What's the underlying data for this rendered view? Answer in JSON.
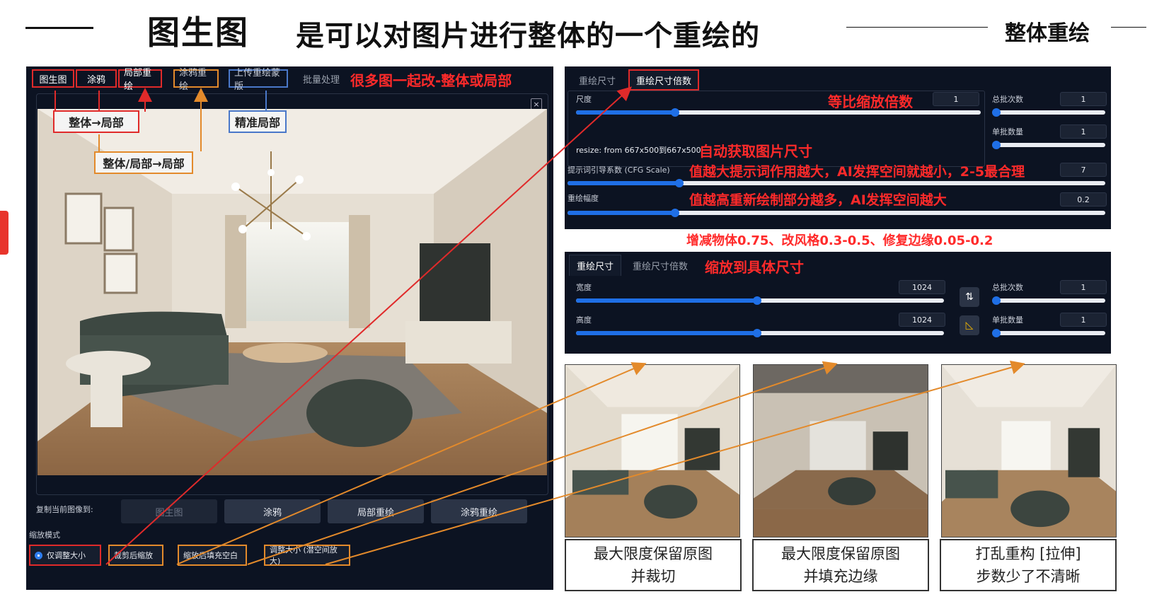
{
  "header": {
    "title": "图生图",
    "subtitle": "是可以对图片进行整体的一个重绘的",
    "right_label": "整体重绘"
  },
  "left_panel": {
    "tabs": [
      {
        "label": "图生图"
      },
      {
        "label": "涂鸦"
      },
      {
        "label": "局部重绘"
      },
      {
        "label": "涂鸦重绘"
      },
      {
        "label": "上传重绘蒙版"
      },
      {
        "label": "批量处理"
      }
    ],
    "tab_note": "很多图一起改-整体或局部",
    "callouts": {
      "whole_to_part": "整体→局部",
      "whole_part_to_part": "整体/局部→局部",
      "precise_part": "精准局部"
    },
    "close_label": "×",
    "copy_label": "复制当前图像到:",
    "copy_buttons": [
      {
        "label": "图生图"
      },
      {
        "label": "涂鸦"
      },
      {
        "label": "局部重绘"
      },
      {
        "label": "涂鸦重绘"
      }
    ],
    "scale_mode_label": "缩放模式",
    "scale_modes": [
      {
        "label": "仅调整大小",
        "selected": true
      },
      {
        "label": "裁剪后缩放",
        "selected": false
      },
      {
        "label": "缩放后填充空白",
        "selected": false
      },
      {
        "label": "调整大小 (潜空间放大)",
        "selected": false
      }
    ]
  },
  "panel_scale_by": {
    "tabs": [
      {
        "label": "重绘尺寸"
      },
      {
        "label": "重绘尺寸倍数"
      }
    ],
    "scale_label": "尺度",
    "scale_value": "1",
    "scale_note": "等比缩放倍数",
    "scale_fraction": 0.22,
    "resize_text": "resize: from 667x500到667x500",
    "resize_note": "自动获取图片尺寸",
    "batch_count_label": "总批次数",
    "batch_count_value": "1",
    "batch_size_label": "单批数量",
    "batch_size_value": "1",
    "cfg_label": "提示词引导系数 (CFG Scale)",
    "cfg_value": "7",
    "cfg_note": "值越大提示词作用越大，AI发挥空间就越小，2-5最合理",
    "denoise_label": "重绘幅度",
    "denoise_value": "0.2",
    "denoise_note": "值越高重新绘制部分越多，AI发挥空间越大"
  },
  "denoise_tip": "增减物体0.75、改风格0.3-0.5、修复边缘0.05-0.2",
  "panel_size": {
    "tabs": [
      {
        "label": "重绘尺寸"
      },
      {
        "label": "重绘尺寸倍数"
      }
    ],
    "tab_note": "缩放到具体尺寸",
    "width_label": "宽度",
    "width_value": "1024",
    "height_label": "高度",
    "height_value": "1024",
    "swap_icon": "swap-icon",
    "ratio_icon": "ruler-icon",
    "batch_count_label": "总批次数",
    "batch_count_value": "1",
    "batch_size_label": "单批数量",
    "batch_size_value": "1"
  },
  "thumbnails": [
    {
      "line1": "最大限度保留原图",
      "line2": "并裁切"
    },
    {
      "line1": "最大限度保留原图",
      "line2": "并填充边缘"
    },
    {
      "line1": "打乱重构 [拉伸]",
      "line2": "步数少了不清晰"
    }
  ],
  "colors": {
    "panel_bg": "#0c1322",
    "accent_blue": "#1f6fe6",
    "annotation_red": "#ff2a2a",
    "annotation_orange": "#e38a2b",
    "annotation_blue": "#4a78c9"
  }
}
